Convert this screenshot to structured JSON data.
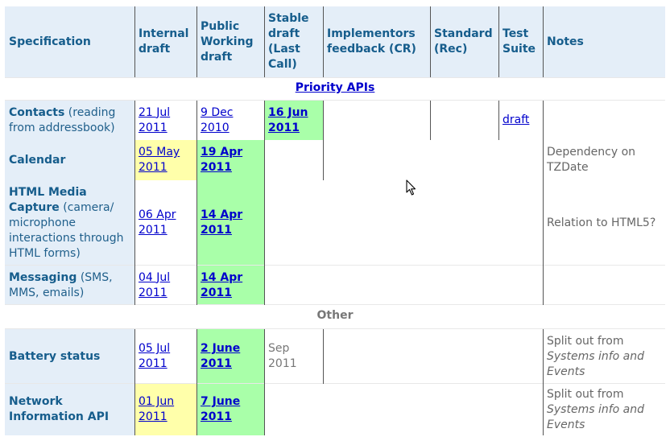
{
  "headers": {
    "specification": "Specification",
    "internal_draft": "Internal draft",
    "public_working_draft": "Public Working draft",
    "stable_draft": "Stable draft (Last Call)",
    "implementors_feedback": "Implementors feedback (CR)",
    "standard": "Standard (Rec)",
    "test_suite": "Test Suite",
    "notes": "Notes"
  },
  "sections": {
    "priority": "Priority APIs",
    "other": "Other"
  },
  "rows": {
    "contacts": {
      "name": "Contacts",
      "desc": "(reading from addressbook)",
      "internal": "21 Jul 2011",
      "public": "9 Dec 2010",
      "stable": "16 Jun 2011",
      "test": "draft",
      "note": ""
    },
    "calendar": {
      "name": "Calendar",
      "internal": "05 May 2011",
      "public": "19 Apr 2011",
      "note": "Dependency on TZDate"
    },
    "capture": {
      "name": "HTML Media Capture",
      "desc": "(camera/ microphone interactions through HTML forms)",
      "internal": "06 Apr 2011",
      "public": "14 Apr 2011",
      "note": "Relation to HTML5?"
    },
    "messaging": {
      "name": "Messaging",
      "desc": "(SMS, MMS, emails)",
      "internal": "04 Jul 2011",
      "public": "14 Apr 2011"
    },
    "battery": {
      "name": "Battery status",
      "internal": "05 Jul 2011",
      "public": "2 June 2011",
      "stable": "Sep 2011",
      "note_prefix": "Split out from",
      "note_italic": "Systems info and Events"
    },
    "network": {
      "name": "Network Information API",
      "internal": "01 Jun 2011",
      "public": "7 June 2011",
      "note_prefix": "Split out from",
      "note_italic": "Systems info and Events"
    }
  },
  "colors": {
    "header_bg": "#e4eef8",
    "draft_yellow": "#ffffaa",
    "draft_green": "#a9ffa9",
    "link": "#0000cc"
  },
  "icons": [
    "mouse-cursor-icon"
  ]
}
